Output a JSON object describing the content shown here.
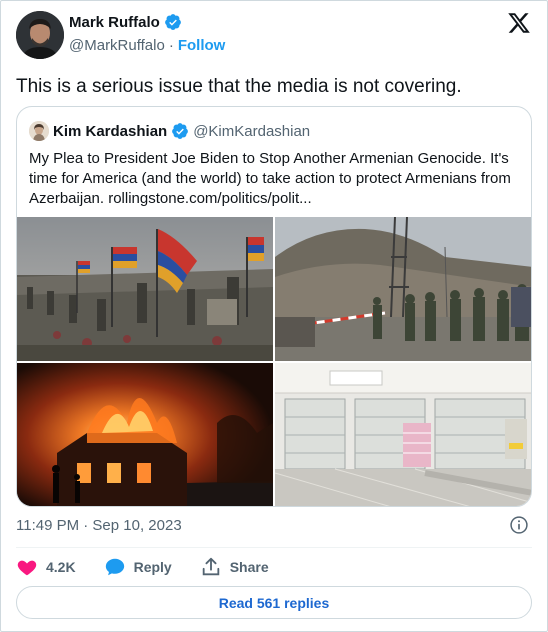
{
  "author": {
    "display_name": "Mark Ruffalo",
    "handle": "@MarkRuffalo",
    "separator": "·",
    "follow_label": "Follow"
  },
  "tweet": {
    "text": "This is a serious issue that the media is not covering."
  },
  "quoted": {
    "display_name": "Kim Kardashian",
    "handle": "@KimKardashian",
    "text": "My Plea to President Joe Biden to Stop Another Armenian Genocide. It's time for America (and the world) to take action to protect Armenians from Azerbaijan. rollingstone.com/politics/polit...",
    "images": [
      "cemetery-with-armenian-flags-photo",
      "soldiers-at-checkpoint-photo",
      "burning-building-at-night-photo",
      "empty-store-shelves-photo"
    ]
  },
  "meta": {
    "timestamp": "11:49 PM · Sep 10, 2023"
  },
  "actions": {
    "likes": "4.2K",
    "reply_label": "Reply",
    "share_label": "Share"
  },
  "read_replies_label": "Read 561 replies",
  "colors": {
    "link_blue": "#1d9bf0",
    "heart_pink": "#f91880",
    "text_gray": "#536471",
    "border": "#cfd9de"
  },
  "icons": [
    "verified-badge-icon",
    "x-logo-icon",
    "info-icon",
    "heart-icon",
    "reply-bubble-icon",
    "share-icon"
  ]
}
